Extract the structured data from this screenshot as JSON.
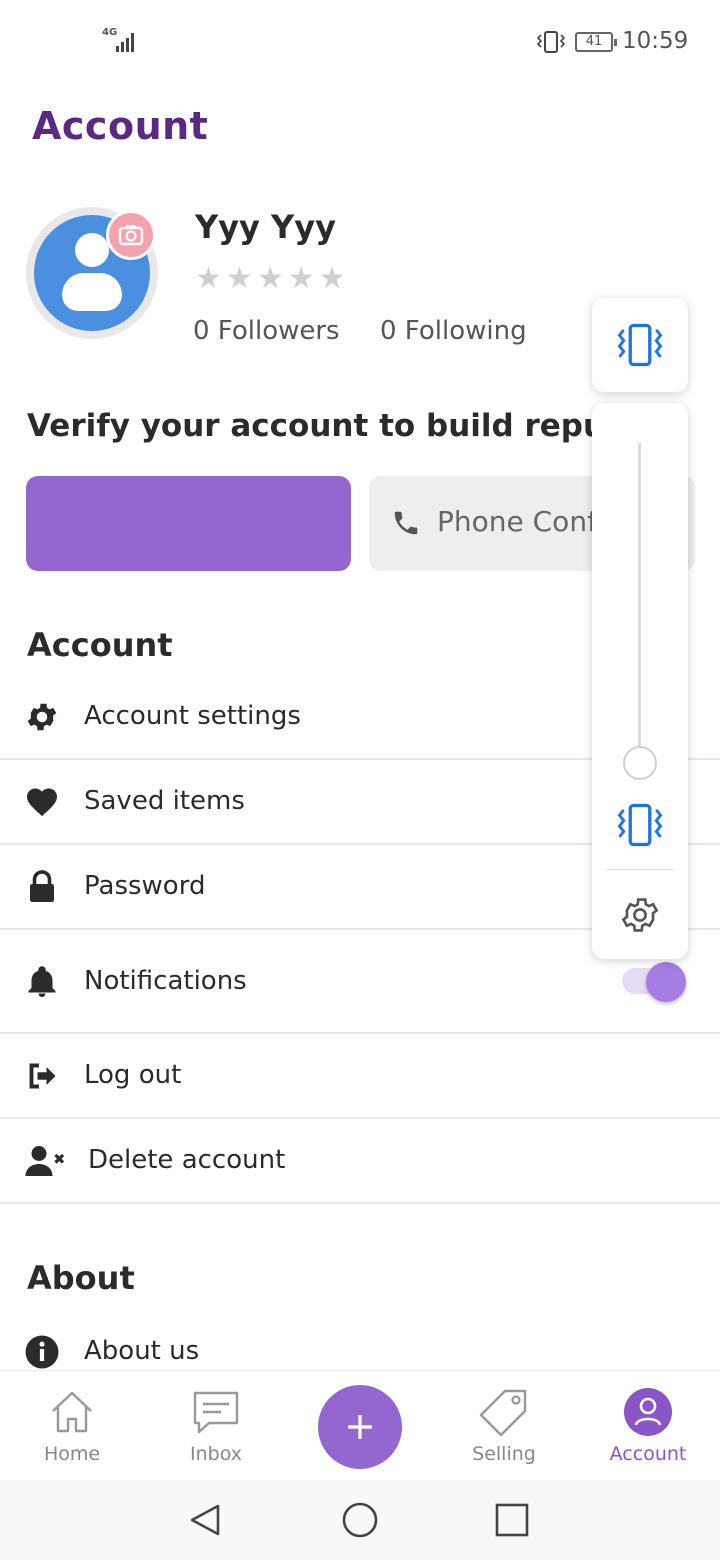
{
  "status_bar": {
    "network": "4G",
    "battery": "41",
    "time": "10:59"
  },
  "header": {
    "title": "Account"
  },
  "profile": {
    "name": "Yyy Yyy",
    "rating": 0,
    "rating_max": 5,
    "followers": "0 Followers",
    "following": "0 Following"
  },
  "verify": {
    "title": "Verify your account to build reputat",
    "phone_button": "Phone Conf"
  },
  "sections": {
    "account": "Account",
    "about": "About"
  },
  "menu": {
    "account_settings": "Account settings",
    "saved_items": "Saved items",
    "password": "Password",
    "notifications": "Notifications",
    "notifications_on": true,
    "log_out": "Log out",
    "delete_account": "Delete account",
    "about_us": "About us"
  },
  "bottom_nav": {
    "home": "Home",
    "inbox": "Inbox",
    "selling": "Selling",
    "account": "Account",
    "active": "account"
  },
  "colors": {
    "accent": "#9467d0",
    "title": "#5a2a82",
    "vibrate_icon": "#1a73e8"
  }
}
